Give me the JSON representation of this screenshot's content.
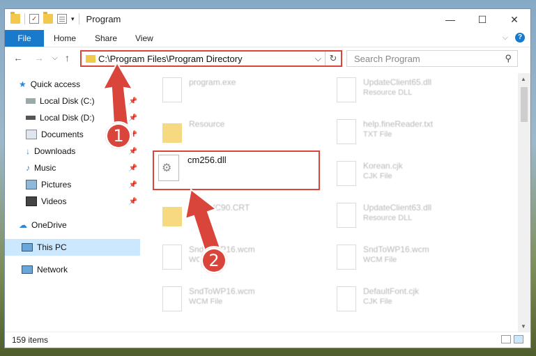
{
  "window": {
    "title": "Program"
  },
  "ribbon": {
    "tabs": [
      "File",
      "Home",
      "Share",
      "View"
    ],
    "help": "?"
  },
  "address": {
    "path": "C:\\Program Files\\Program Directory",
    "chevron": "⌵",
    "refresh": "↻"
  },
  "search": {
    "placeholder": "Search Program"
  },
  "nav": {
    "back": "←",
    "forward": "→",
    "down": "⌵",
    "up": "↑"
  },
  "sidebar": {
    "quick_access": "Quick access",
    "items": [
      {
        "label": "Local Disk (C:)",
        "icon": "drive-icon"
      },
      {
        "label": "Local Disk (D:)",
        "icon": "drive-icon"
      },
      {
        "label": "Documents",
        "icon": "documents-icon"
      },
      {
        "label": "Downloads",
        "icon": "download-icon"
      },
      {
        "label": "Music",
        "icon": "music-icon"
      },
      {
        "label": "Pictures",
        "icon": "pictures-icon"
      },
      {
        "label": "Videos",
        "icon": "videos-icon"
      }
    ],
    "onedrive": "OneDrive",
    "thispc": "This PC",
    "network": "Network"
  },
  "files": {
    "left": [
      {
        "name": "program.exe",
        "type": ""
      },
      {
        "name": "Resource",
        "type": ""
      },
      {
        "name": "cm256.dll",
        "type": ""
      },
      {
        "name": "osoft.VC90.CRT",
        "type": ""
      },
      {
        "name": "SndToWP16.wcm",
        "type": "WCM File"
      },
      {
        "name": "SndToWP16.wcm",
        "type": "WCM File"
      }
    ],
    "right": [
      {
        "name": "UpdateClient65.dll",
        "type": "Resource DLL"
      },
      {
        "name": "help.fineReader.txt",
        "type": "TXT File"
      },
      {
        "name": "Korean.cjk",
        "type": "CJK File"
      },
      {
        "name": "UpdateClient63.dll",
        "type": "Resource DLL"
      },
      {
        "name": "SndToWP16.wcm",
        "type": "WCM File"
      },
      {
        "name": "DefaultFont.cjk",
        "type": "CJK File"
      }
    ]
  },
  "annotations": {
    "step1": "1",
    "step2": "2"
  },
  "status": {
    "items": "159 items"
  },
  "colors": {
    "accent": "#1979ca",
    "highlight": "#d9443b"
  }
}
